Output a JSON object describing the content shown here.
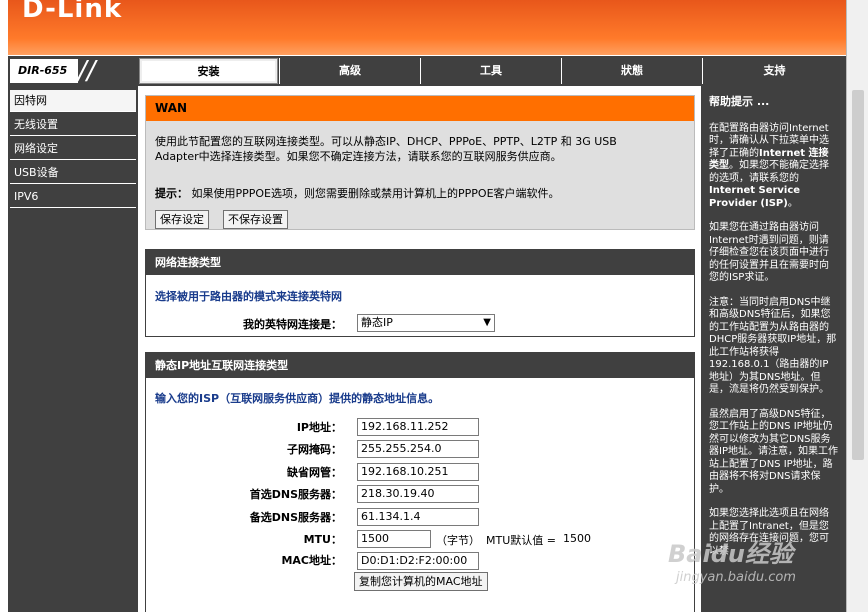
{
  "header": {
    "logo": "D-Link"
  },
  "nav": {
    "model": "DIR-655",
    "tabs": [
      {
        "label": "安装",
        "active": true
      },
      {
        "label": "高级",
        "active": false
      },
      {
        "label": "工具",
        "active": false
      },
      {
        "label": "狀態",
        "active": false
      },
      {
        "label": "支持",
        "active": false
      }
    ]
  },
  "sidebar": {
    "items": [
      {
        "label": "因特网",
        "active": true
      },
      {
        "label": "无线设置",
        "active": false
      },
      {
        "label": "网络设定",
        "active": false
      },
      {
        "label": "USB设备",
        "active": false
      },
      {
        "label": "IPV6",
        "active": false
      }
    ]
  },
  "wan": {
    "title": "WAN",
    "description_line1": "使用此节配置您的互联网连接类型。可以从静态IP、DHCP、PPPoE、PPTP、L2TP 和 3G USB",
    "description_line2": "Adapter中选择连接类型。如果您不确定连接方法，请联系您的互联网服务供应商。",
    "tip_label": "提示：",
    "tip_text": "如果使用PPPOE选项，则您需要删除或禁用计算机上的PPPOE客户端软件。",
    "save_label": "保存设定",
    "dont_save_label": "不保存设置"
  },
  "connection": {
    "title": "网络连接类型",
    "subtitle": "选择被用于路由器的模式来连接英特网",
    "label": "我的英特网连接是：",
    "selected": "静态IP"
  },
  "static_ip": {
    "title": "静态IP地址互联网连接类型",
    "subtitle": "输入您的ISP（互联网服务供应商）提供的静态地址信息。",
    "ip_label": "IP地址：",
    "ip_value": "192.168.11.252",
    "mask_label": "子网掩码：",
    "mask_value": "255.255.254.0",
    "gateway_label": "缺省网管：",
    "gateway_value": "192.168.10.251",
    "dns1_label": "首选DNS服务器：",
    "dns1_value": "218.30.19.40",
    "dns2_label": "备选DNS服务器：",
    "dns2_value": "61.134.1.4",
    "mtu_label": "MTU：",
    "mtu_value": "1500",
    "mtu_unit": "（字节）",
    "mtu_default": "MTU默认值 =",
    "mtu_default_value": "1500",
    "mac_label": "MAC地址：",
    "mac_value": "D0:D1:D2:F2:00:00",
    "clone_mac_label": "复制您计算机的MAC地址"
  },
  "help": {
    "title": "帮助提示 ...",
    "p1_a": "在配置路由器访问Internet时，请确认从下拉菜单中选择了正确的",
    "p1_b": "Internet 连接类型",
    "p1_c": "。如果您不能确定选择的选项，请联系您的",
    "p1_d": "Internet Service Provider (ISP)",
    "p1_e": "。",
    "p2": "如果您在通过路由器访问Internet时遇到问题，则请仔细检查您在该页面中进行的任何设置并且在需要时向您的ISP求证。",
    "p3": "注意：当同时启用DNS中继和高级DNS特征后，如果您的工作站配置为从路由器的DHCP服务器获取IP地址，那此工作站将获得 192.168.0.1（路由器的IP地址）为其DNS地址。但是，流是将仍然受到保护。",
    "p4": "虽然启用了高级DNS特征，您工作站上的DNS IP地址仍然可以修改为其它DNS服务器IP地址。请注意，如果工作站上配置了DNS IP地址，路由器将不将对DNS请求保护。",
    "p5": "如果您选择此选项且在网络上配置了Intranet，但是您的网络存在连接问题，您可以禁"
  },
  "watermark": {
    "text": "Baidu经验",
    "sub": "jingyan.baidu.com"
  }
}
